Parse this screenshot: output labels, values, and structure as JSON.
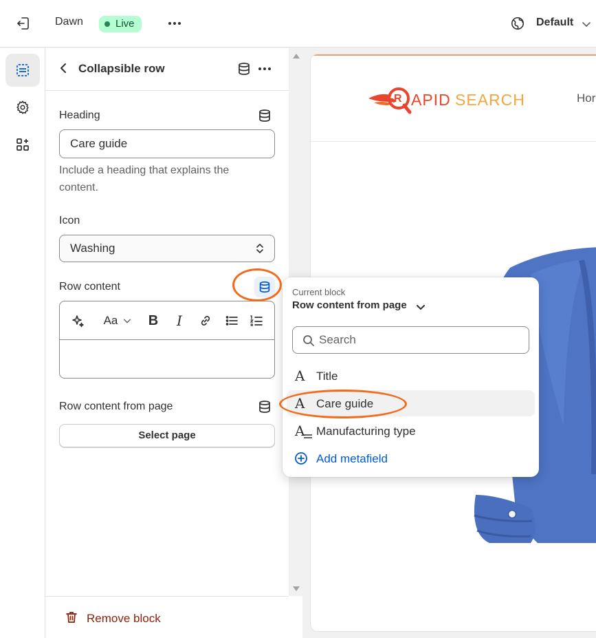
{
  "topbar": {
    "theme_name": "Dawn",
    "live_badge": "Live",
    "locale": "Default"
  },
  "panel": {
    "title": "Collapsible row",
    "heading_label": "Heading",
    "heading_value": "Care guide",
    "heading_help": "Include a heading that explains the content.",
    "icon_label": "Icon",
    "icon_value": "Washing",
    "row_content_label": "Row content",
    "row_content_page_label": "Row content from page",
    "select_page_button": "Select page",
    "remove_block": "Remove block"
  },
  "popover": {
    "caption": "Current block",
    "current_source": "Row content from page",
    "search_placeholder": "Search",
    "options": [
      {
        "glyph": "A",
        "label": "Title"
      },
      {
        "glyph": "A",
        "label": "Care guide"
      },
      {
        "glyph": "A",
        "label": "Manufacturing type"
      }
    ],
    "add_metafield": "Add metafield"
  },
  "preview": {
    "logo_word1": "APID",
    "logo_letter": "R",
    "logo_word2": "SEARCH",
    "nav_home": "Hor"
  },
  "colors": {
    "accent_blue": "#005bd3",
    "highlight_ring": "#f26a1b",
    "live_badge_bg": "#b4fed2",
    "critical": "#8e1f0b"
  }
}
